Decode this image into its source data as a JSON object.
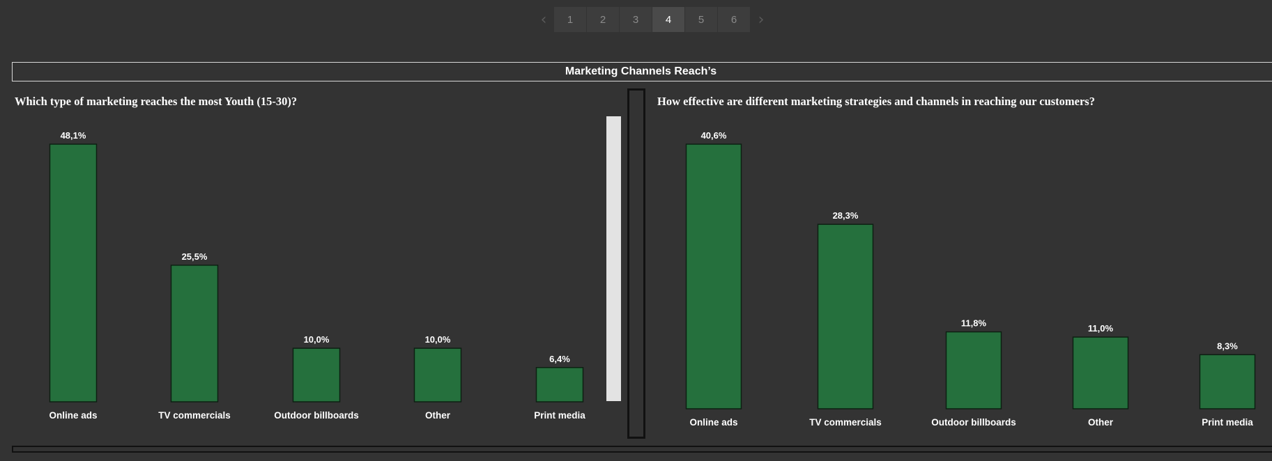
{
  "pager": {
    "prev_icon": "chevron-left-icon",
    "next_icon": "chevron-right-icon",
    "pages": [
      "1",
      "2",
      "3",
      "4",
      "5",
      "6"
    ],
    "active": "4"
  },
  "dashboard": {
    "title": "Marketing Channels Reach’s"
  },
  "colors": {
    "bar": "#25703D",
    "bar_border": "#0d1f12",
    "background": "#333333"
  },
  "chart_data": [
    {
      "type": "bar",
      "title": "Which type of marketing reaches the most Youth (15-30)?",
      "categories": [
        "Online ads",
        "TV commercials",
        "Outdoor billboards",
        "Other",
        "Print media"
      ],
      "values": [
        48.1,
        25.5,
        10.0,
        10.0,
        6.4
      ],
      "labels": [
        "48,1%",
        "25,5%",
        "10,0%",
        "10,0%",
        "6,4%"
      ],
      "ylim": [
        0,
        48.1
      ],
      "grid": false
    },
    {
      "type": "bar",
      "title": "How effective are different marketing strategies and channels in reaching our customers?",
      "categories": [
        "Online ads",
        "TV commercials",
        "Outdoor billboards",
        "Other",
        "Print media"
      ],
      "values": [
        40.6,
        28.3,
        11.8,
        11.0,
        8.3
      ],
      "labels": [
        "40,6%",
        "28,3%",
        "11,8%",
        "11,0%",
        "8,3%"
      ],
      "ylim": [
        0,
        40.6
      ],
      "grid": false
    }
  ]
}
